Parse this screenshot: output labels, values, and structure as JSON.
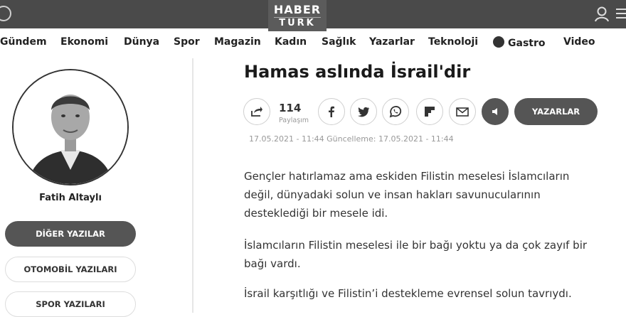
{
  "header": {
    "logo_line1": "HABER",
    "logo_line2": "TURK"
  },
  "nav": {
    "items": [
      "Gündem",
      "Ekonomi",
      "Dünya",
      "Spor",
      "Magazin",
      "Kadın",
      "Sağlık",
      "Yazarlar",
      "Teknoloji",
      "Gastro",
      "Video"
    ]
  },
  "author": {
    "name": "Fatih Altaylı"
  },
  "sidebar": {
    "buttons": [
      "DİĞER YAZILAR",
      "OTOMOBİL YAZILARI",
      "SPOR YAZILARI"
    ]
  },
  "article": {
    "title": "Hamas aslında İsrail'dir",
    "share_count": "114",
    "share_label": "Paylaşım",
    "authors_button": "YAZARLAR",
    "dates": "17.05.2021 - 11:44 Güncelleme: 17.05.2021 - 11:44",
    "paragraphs": [
      "Gençler hatırlamaz ama eskiden Filistin meselesi İslamcıların değil, dünyadaki solun ve insan hakları savunucularının desteklediği bir mesele idi.",
      "İslamcıların Filistin meselesi ile bir bağı yoktu ya da çok zayıf bir bağı vardı.",
      "İsrail karşıtlığı ve Filistin’i destekleme evrensel solun tavrıydı."
    ]
  },
  "colors": {
    "topbar": "#4a4a4a",
    "dark_button": "#555555"
  },
  "icons": [
    "share-icon",
    "facebook-icon",
    "twitter-icon",
    "whatsapp-icon",
    "flipboard-icon",
    "email-icon",
    "speaker-icon",
    "user-icon",
    "menu-icon"
  ]
}
